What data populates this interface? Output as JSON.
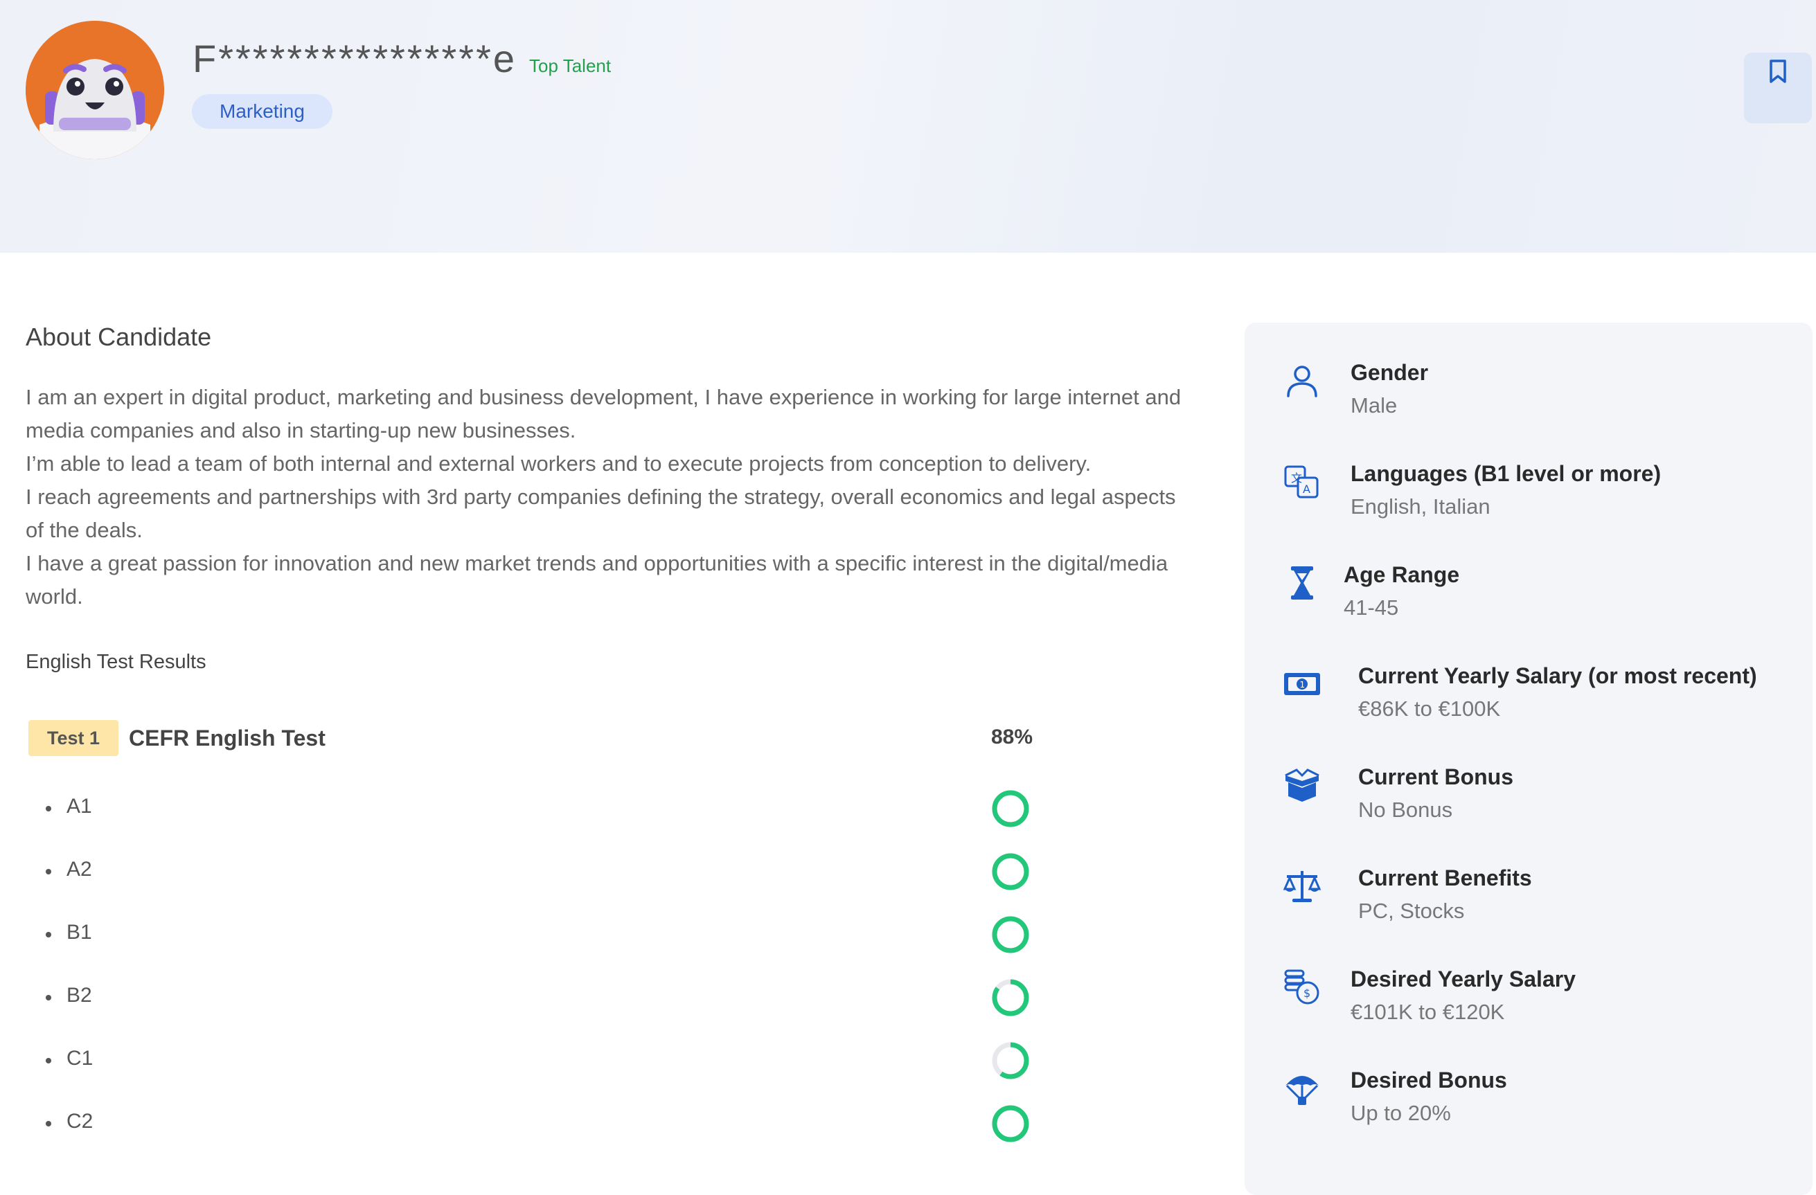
{
  "header": {
    "name": "F****************e",
    "badge": "Top Talent",
    "tag": "Marketing"
  },
  "about": {
    "title": "About Candidate",
    "paragraphs": [
      "I am an expert in digital product, marketing and business development, I have experience in working for large internet and media companies and also in starting-up new businesses.",
      "I’m able to lead a team of both internal and external workers and to execute projects from conception to delivery.",
      "I reach agreements and partnerships with 3rd party companies defining the strategy, overall economics and legal aspects of the deals.",
      "I have a great passion for innovation and new market trends and opportunities with a specific interest in the digital/media world."
    ]
  },
  "tests": {
    "title": "English Test Results",
    "test_badge": "Test 1",
    "test_name": "CEFR English Test",
    "score": "88%",
    "levels": [
      {
        "name": "A1",
        "fill": 1.0
      },
      {
        "name": "A2",
        "fill": 1.0
      },
      {
        "name": "B1",
        "fill": 1.0
      },
      {
        "name": "B2",
        "fill": 0.85
      },
      {
        "name": "C1",
        "fill": 0.6
      },
      {
        "name": "C2",
        "fill": 1.0
      }
    ]
  },
  "profile": {
    "items": [
      {
        "icon": "person-icon",
        "label": "Gender",
        "value": "Male"
      },
      {
        "icon": "translate-icon",
        "label": "Languages (B1 level or more)",
        "value": "English, Italian"
      },
      {
        "icon": "hourglass-icon",
        "label": "Age Range",
        "value": "41-45"
      },
      {
        "icon": "banknote-icon",
        "label": "Current Yearly Salary (or most recent)",
        "value": "€86K to €100K"
      },
      {
        "icon": "gift-box-icon",
        "label": "Current Bonus",
        "value": "No Bonus"
      },
      {
        "icon": "scales-icon",
        "label": "Current Benefits",
        "value": "PC, Stocks"
      },
      {
        "icon": "coins-icon",
        "label": "Desired Yearly Salary",
        "value": "€101K to €120K"
      },
      {
        "icon": "parachute-icon",
        "label": "Desired Bonus",
        "value": "Up to 20%"
      }
    ]
  },
  "colors": {
    "accent": "#1f5fc8",
    "ring": "#22c77a",
    "top_talent": "#22a04b",
    "tag_bg": "#dbe5fb"
  }
}
